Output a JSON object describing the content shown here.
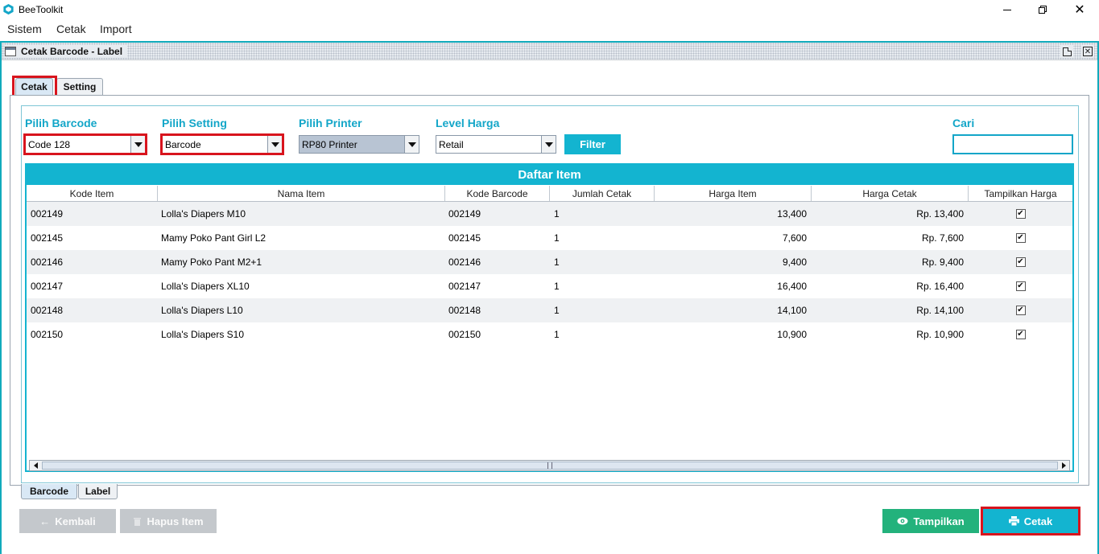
{
  "app": {
    "title": "BeeToolkit"
  },
  "menu": {
    "items": [
      "Sistem",
      "Cetak",
      "Import"
    ]
  },
  "window": {
    "title": "Cetak Barcode - Label"
  },
  "tabs": {
    "top": [
      "Cetak",
      "Setting"
    ],
    "bottom": [
      "Barcode",
      "Label"
    ]
  },
  "filters": {
    "barcode": {
      "label": "Pilih Barcode",
      "value": "Code 128"
    },
    "setting": {
      "label": "Pilih Setting",
      "value": "Barcode"
    },
    "printer": {
      "label": "Pilih Printer",
      "value": "RP80 Printer"
    },
    "level": {
      "label": "Level Harga",
      "value": "Retail"
    },
    "filter_button": "Filter",
    "search": {
      "label": "Cari",
      "value": ""
    }
  },
  "table": {
    "title": "Daftar Item",
    "columns": [
      "Kode Item",
      "Nama Item",
      "Kode Barcode",
      "Jumlah Cetak",
      "Harga Item",
      "Harga Cetak",
      "Tampilkan Harga"
    ],
    "rows": [
      {
        "kode": "002149",
        "nama": "Lolla's Diapers M10",
        "barcode": "002149",
        "jumlah": "1",
        "harga": "13,400",
        "cetak": "Rp. 13,400",
        "tampil": true
      },
      {
        "kode": "002145",
        "nama": "Mamy Poko Pant Girl L2",
        "barcode": "002145",
        "jumlah": "1",
        "harga": "7,600",
        "cetak": "Rp. 7,600",
        "tampil": true
      },
      {
        "kode": "002146",
        "nama": "Mamy Poko Pant M2+1",
        "barcode": "002146",
        "jumlah": "1",
        "harga": "9,400",
        "cetak": "Rp. 9,400",
        "tampil": true
      },
      {
        "kode": "002147",
        "nama": "Lolla's Diapers XL10",
        "barcode": "002147",
        "jumlah": "1",
        "harga": "16,400",
        "cetak": "Rp. 16,400",
        "tampil": true
      },
      {
        "kode": "002148",
        "nama": "Lolla's Diapers L10",
        "barcode": "002148",
        "jumlah": "1",
        "harga": "14,100",
        "cetak": "Rp. 14,100",
        "tampil": true
      },
      {
        "kode": "002150",
        "nama": "Lolla's Diapers S10",
        "barcode": "002150",
        "jumlah": "1",
        "harga": "10,900",
        "cetak": "Rp. 10,900",
        "tampil": true
      }
    ]
  },
  "buttons": {
    "kembali": "Kembali",
    "hapus": "Hapus Item",
    "tampilkan": "Tampilkan",
    "cetak": "Cetak"
  },
  "colors": {
    "accent": "#13b4d0",
    "label": "#13a6c8",
    "green": "#23b27c",
    "highlight": "#d8141d",
    "disabled": "#c4c8cc"
  },
  "icons": {
    "app": "bee-logo-icon",
    "minimize": "minimize-icon",
    "maximize": "restore-icon",
    "close": "close-icon",
    "kembali": "arrow-left-icon",
    "hapus": "trash-icon",
    "tampilkan": "eye-icon",
    "cetak": "printer-icon"
  }
}
